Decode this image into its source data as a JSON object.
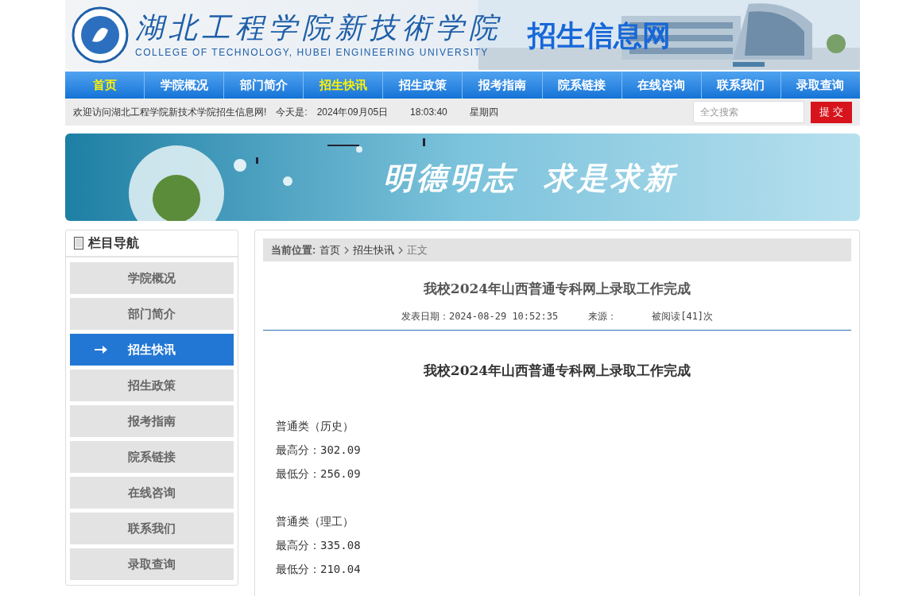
{
  "header": {
    "logo_title": "湖北工程学院新技術学院",
    "logo_subtitle": "COLLEGE OF TECHNOLOGY, HUBEI ENGINEERING UNIVERSITY",
    "site_name": "招生信息网"
  },
  "nav": [
    {
      "label": "首页",
      "highlighted": true
    },
    {
      "label": "学院概况",
      "highlighted": false
    },
    {
      "label": "部门简介",
      "highlighted": false
    },
    {
      "label": "招生快讯",
      "highlighted": true
    },
    {
      "label": "招生政策",
      "highlighted": false
    },
    {
      "label": "报考指南",
      "highlighted": false
    },
    {
      "label": "院系链接",
      "highlighted": false
    },
    {
      "label": "在线咨询",
      "highlighted": false
    },
    {
      "label": "联系我们",
      "highlighted": false
    },
    {
      "label": "录取查询",
      "highlighted": false
    }
  ],
  "info_bar": {
    "welcome": "欢迎访问湖北工程学院新技术学院招生信息网!",
    "today_label": "今天是:",
    "date": "2024年09月05日",
    "time": "18:03:40",
    "weekday": "星期四",
    "search": {
      "placeholder": "全文搜索"
    },
    "submit": "提 交"
  },
  "banner": {
    "motto": "明德明志  求是求新"
  },
  "sidebar": {
    "title": "栏目导航",
    "items": [
      {
        "label": "学院概况",
        "selected": false
      },
      {
        "label": "部门简介",
        "selected": false
      },
      {
        "label": "招生快讯",
        "selected": true
      },
      {
        "label": "招生政策",
        "selected": false
      },
      {
        "label": "报考指南",
        "selected": false
      },
      {
        "label": "院系链接",
        "selected": false
      },
      {
        "label": "在线咨询",
        "selected": false
      },
      {
        "label": "联系我们",
        "selected": false
      },
      {
        "label": "录取查询",
        "selected": false
      }
    ]
  },
  "breadcrumb": {
    "label": "当前位置:",
    "items": [
      "首页",
      "招生快讯",
      "正文"
    ]
  },
  "article": {
    "title": "我校2024年山西普通专科网上录取工作完成",
    "published": "发表日期：2024-08-29 10:52:35",
    "source": "来源：",
    "views": "被阅读[41]次",
    "heading": "我校2024年山西普通专科网上录取工作完成",
    "sections": [
      [
        "普通类（历史）",
        "最高分：302.09",
        "最低分：256.09"
      ],
      [
        "普通类（理工）",
        "最高分：335.08",
        "最低分：210.04"
      ]
    ]
  }
}
